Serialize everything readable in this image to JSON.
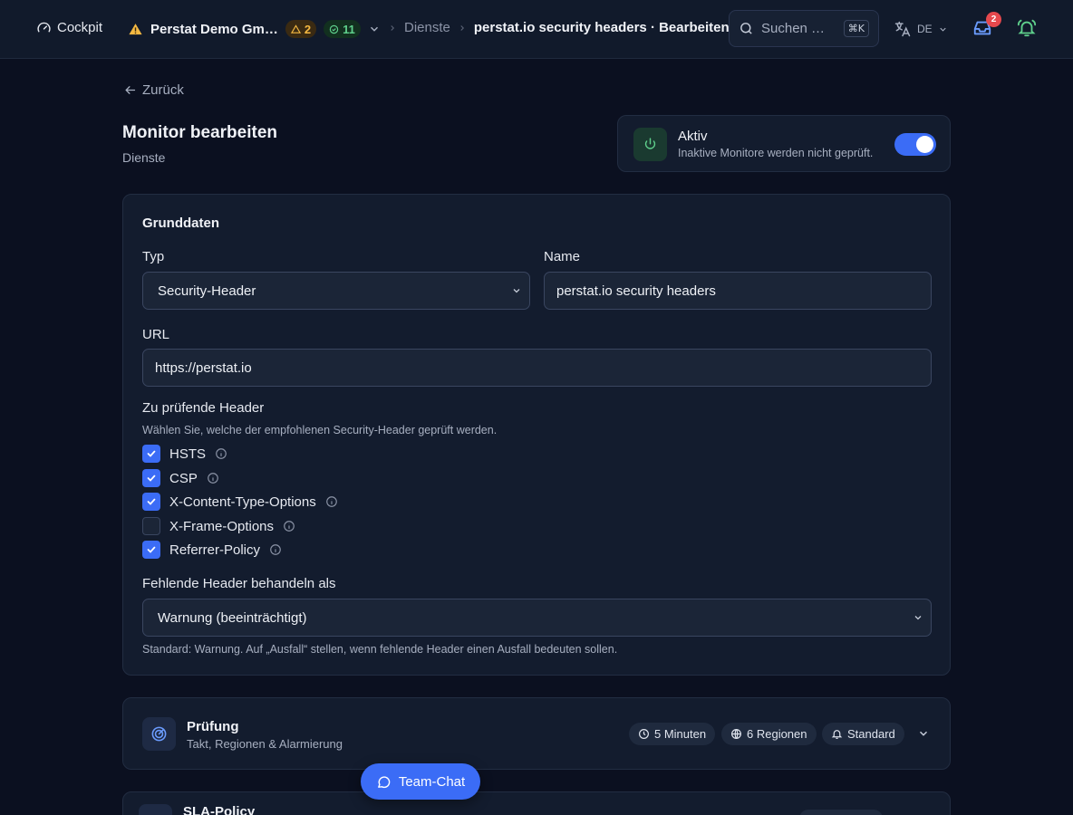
{
  "topbar": {
    "cockpit_label": "Cockpit",
    "org_name": "Perstat Demo Gm…",
    "warn_count": "2",
    "ok_count": "11",
    "breadcrumb_parent": "Dienste",
    "breadcrumb_current": "perstat.io security headers · Bearbeiten",
    "search_placeholder": "Suchen …",
    "search_shortcut": "⌘K",
    "language": "DE",
    "inbox_badge": "2"
  },
  "page": {
    "back_label": "Zurück",
    "title": "Monitor bearbeiten",
    "subtitle": "Dienste"
  },
  "active_card": {
    "title": "Aktiv",
    "description": "Inaktive Monitore werden nicht geprüft.",
    "enabled": true
  },
  "grunddaten": {
    "section_title": "Grunddaten",
    "typ_label": "Typ",
    "typ_value": "Security-Header",
    "name_label": "Name",
    "name_value": "perstat.io security headers",
    "url_label": "URL",
    "url_value": "https://perstat.io",
    "headers_label": "Zu prüfende Header",
    "headers_help": "Wählen Sie, welche der empfohlenen Security-Header geprüft werden.",
    "headers": [
      {
        "label": "HSTS",
        "checked": true
      },
      {
        "label": "CSP",
        "checked": true
      },
      {
        "label": "X-Content-Type-Options",
        "checked": true
      },
      {
        "label": "X-Frame-Options",
        "checked": false
      },
      {
        "label": "Referrer-Policy",
        "checked": true
      }
    ],
    "missing_label": "Fehlende Header behandeln als",
    "missing_value": "Warnung (beeinträchtigt)",
    "missing_help": "Standard: Warnung. Auf „Ausfall“ stellen, wenn fehlende Header einen Ausfall bedeuten sollen."
  },
  "pruefung": {
    "title": "Prüfung",
    "subtitle": "Takt, Regionen & Alarmierung",
    "chip_interval": "5 Minuten",
    "chip_regions": "6 Regionen",
    "chip_alert": "Standard"
  },
  "sla": {
    "title": "SLA-Policy"
  },
  "team_chat_label": "Team-Chat",
  "colors": {
    "accent": "#3b6cf6",
    "background": "#0b1020",
    "card": "#131c2e",
    "warning": "#f5b942",
    "success": "#5fd08c",
    "danger": "#e5484d"
  }
}
